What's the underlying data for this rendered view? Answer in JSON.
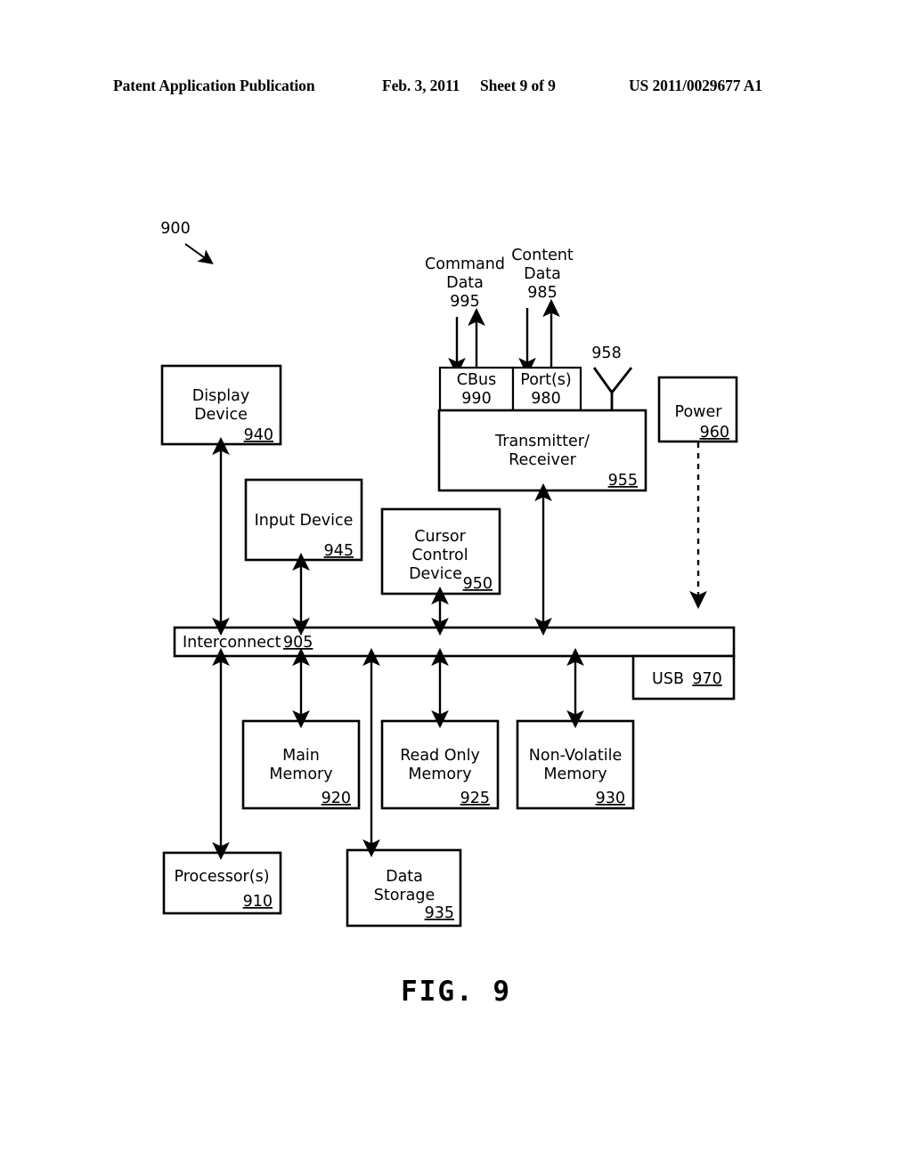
{
  "header": {
    "title": "Patent Application Publication",
    "date": "Feb. 3, 2011",
    "sheet": "Sheet 9 of 9",
    "publication_number": "US 2011/0029677 A1"
  },
  "figure": {
    "caption": "FIG. 9",
    "system_ref": "900"
  },
  "callouts": {
    "command_data_l1": "Command",
    "command_data_l2": "Data",
    "command_data_ref": "995",
    "content_data_l1": "Content",
    "content_data_l2": "Data",
    "content_data_ref": "985",
    "antenna_ref": "958"
  },
  "blocks": {
    "display_device": {
      "line1": "Display",
      "line2": "Device",
      "ref": "940"
    },
    "input_device": {
      "line1": "Input Device",
      "ref": "945"
    },
    "cursor_control": {
      "line1": "Cursor",
      "line2": "Control",
      "line3": "Device",
      "ref": "950"
    },
    "cbus": {
      "line1": "CBus",
      "ref": "990"
    },
    "ports": {
      "line1": "Port(s)",
      "ref": "980"
    },
    "transceiver": {
      "line1": "Transmitter/",
      "line2": "Receiver",
      "ref": "955"
    },
    "power": {
      "line1": "Power",
      "ref": "960"
    },
    "interconnect": {
      "line1": "Interconnect",
      "ref": "905"
    },
    "usb": {
      "line1": "USB",
      "ref": "970"
    },
    "main_memory": {
      "line1": "Main",
      "line2": "Memory",
      "ref": "920"
    },
    "read_only_memory": {
      "line1": "Read Only",
      "line2": "Memory",
      "ref": "925"
    },
    "non_volatile_memory": {
      "line1": "Non-Volatile",
      "line2": "Memory",
      "ref": "930"
    },
    "processors": {
      "line1": "Processor(s)",
      "ref": "910"
    },
    "data_storage": {
      "line1": "Data",
      "line2": "Storage",
      "ref": "935"
    }
  },
  "colors": {
    "ink": "#000000",
    "paper": "#ffffff"
  }
}
